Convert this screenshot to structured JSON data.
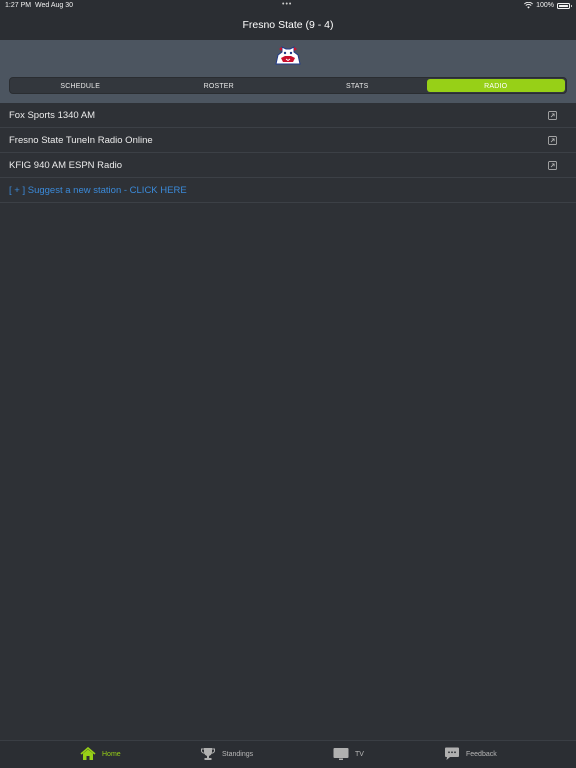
{
  "status_bar": {
    "time": "1:27 PM",
    "date": "Wed Aug 30",
    "multitask_dots": "•••",
    "battery": "100%"
  },
  "nav": {
    "title": "Fresno State (9 - 4)"
  },
  "header": {
    "logo_icon": "bulldog-logo-icon"
  },
  "segments": [
    {
      "label": "SCHEDULE",
      "active": false
    },
    {
      "label": "ROSTER",
      "active": false
    },
    {
      "label": "STATS",
      "active": false
    },
    {
      "label": "RADIO",
      "active": true
    }
  ],
  "stations": [
    {
      "label": "Fox Sports 1340 AM",
      "icon": "external-link-icon"
    },
    {
      "label": "Fresno State TuneIn Radio Online",
      "icon": "external-link-icon"
    },
    {
      "label": "KFIG 940 AM ESPN Radio",
      "icon": "external-link-icon"
    }
  ],
  "suggest": {
    "label": "[ + ] Suggest a new station - CLICK HERE"
  },
  "tab_bar": [
    {
      "label": "Home",
      "icon": "home-icon",
      "active": true
    },
    {
      "label": "Standings",
      "icon": "trophy-icon",
      "active": false
    },
    {
      "label": "TV",
      "icon": "tv-icon",
      "active": false
    },
    {
      "label": "Feedback",
      "icon": "chat-bubble-icon",
      "active": false
    }
  ],
  "colors": {
    "accent": "#97d017",
    "background": "#2e3136",
    "header_band": "#4c5560",
    "link": "#3b8ad9"
  }
}
